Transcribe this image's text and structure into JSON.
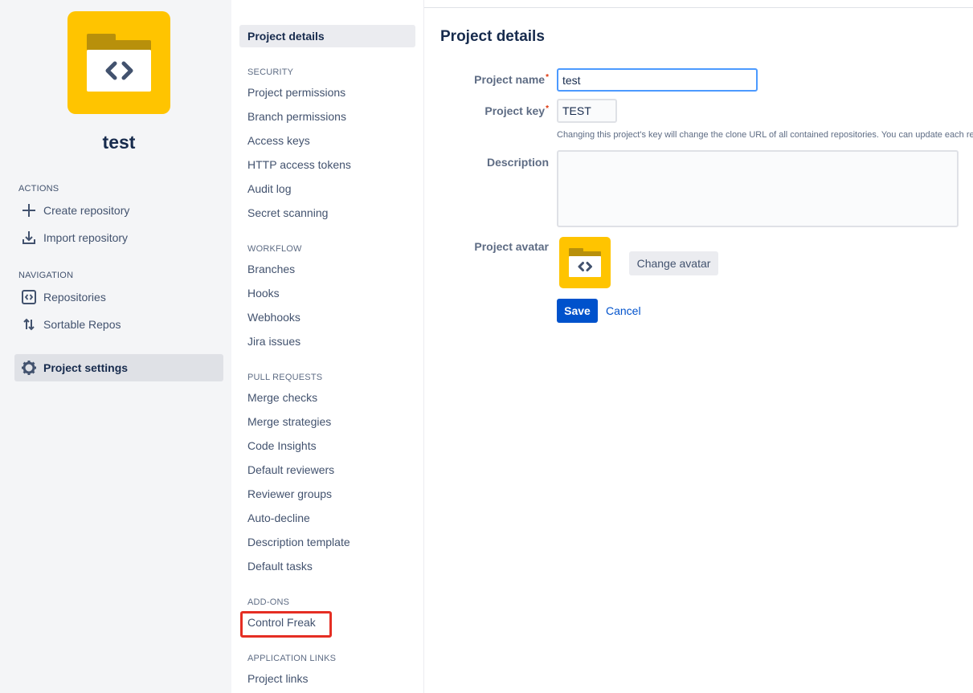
{
  "project": {
    "name": "test"
  },
  "left_nav": {
    "actions_heading": "ACTIONS",
    "actions": [
      {
        "label": "Create repository",
        "icon": "plus-icon"
      },
      {
        "label": "Import repository",
        "icon": "import-icon"
      }
    ],
    "navigation_heading": "NAVIGATION",
    "navigation": [
      {
        "label": "Repositories",
        "icon": "code-icon"
      },
      {
        "label": "Sortable Repos",
        "icon": "sort-icon"
      }
    ],
    "settings": {
      "label": "Project settings",
      "icon": "gear-icon"
    }
  },
  "settings_nav": {
    "active": "Project details",
    "security_heading": "SECURITY",
    "security": [
      "Project permissions",
      "Branch permissions",
      "Access keys",
      "HTTP access tokens",
      "Audit log",
      "Secret scanning"
    ],
    "workflow_heading": "WORKFLOW",
    "workflow": [
      "Branches",
      "Hooks",
      "Webhooks",
      "Jira issues"
    ],
    "pull_requests_heading": "PULL REQUESTS",
    "pull_requests": [
      "Merge checks",
      "Merge strategies",
      "Code Insights",
      "Default reviewers",
      "Reviewer groups",
      "Auto-decline",
      "Description template",
      "Default tasks"
    ],
    "addons_heading": "ADD-ONS",
    "addons": [
      "Control Freak"
    ],
    "app_links_heading": "APPLICATION LINKS",
    "app_links": [
      "Project links"
    ]
  },
  "form": {
    "title": "Project details",
    "name_label": "Project name",
    "name_value": "test",
    "key_label": "Project key",
    "key_value": "TEST",
    "required_mark": "*",
    "key_help": "Changing this project's key will change the clone URL of all contained repositories. You can update each rep",
    "description_label": "Description",
    "description_value": "",
    "avatar_label": "Project avatar",
    "change_avatar": "Change avatar",
    "save": "Save",
    "cancel": "Cancel"
  },
  "colors": {
    "avatar": "#ffc400",
    "primary": "#0052cc",
    "highlight": "#e52e23",
    "focus": "#4c9aff"
  }
}
